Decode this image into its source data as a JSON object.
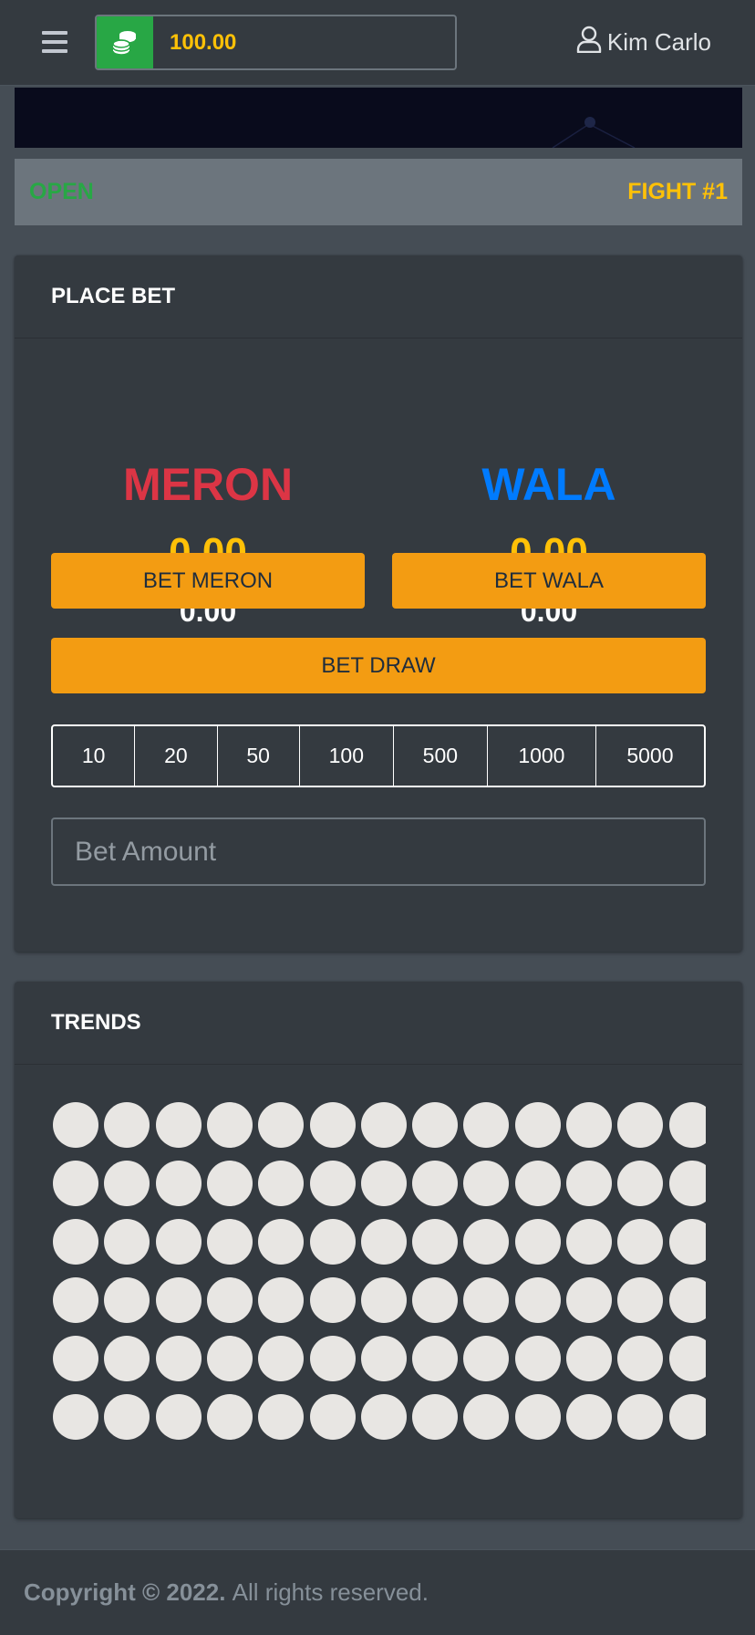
{
  "header": {
    "wallet_balance": "100.00",
    "user_name": "Kim Carlo"
  },
  "status": {
    "betting_state": "OPEN",
    "fight_label": "FIGHT #1"
  },
  "bet_card": {
    "title": "PLACE BET",
    "meron": {
      "name": "MERON",
      "total": "0.00",
      "my_bet": "0.00",
      "button_label": "BET MERON"
    },
    "wala": {
      "name": "WALA",
      "total": "0.00",
      "my_bet": "0.00",
      "button_label": "BET WALA"
    },
    "draw_button_label": "BET DRAW",
    "chips": [
      "10",
      "20",
      "50",
      "100",
      "500",
      "1000",
      "5000"
    ],
    "amount_placeholder": "Bet Amount",
    "amount_value": ""
  },
  "trends": {
    "title": "TRENDS",
    "rows": 6,
    "cols": 13
  },
  "footer": {
    "copyright": "Copyright © 2022.",
    "rights": "All rights reserved."
  },
  "colors": {
    "meron": "#dc3545",
    "wala": "#007bff",
    "accent": "#ffc107",
    "button": "#f39c12",
    "open": "#28a745"
  },
  "icons": [
    "menu-icon",
    "coins-icon",
    "user-icon"
  ]
}
